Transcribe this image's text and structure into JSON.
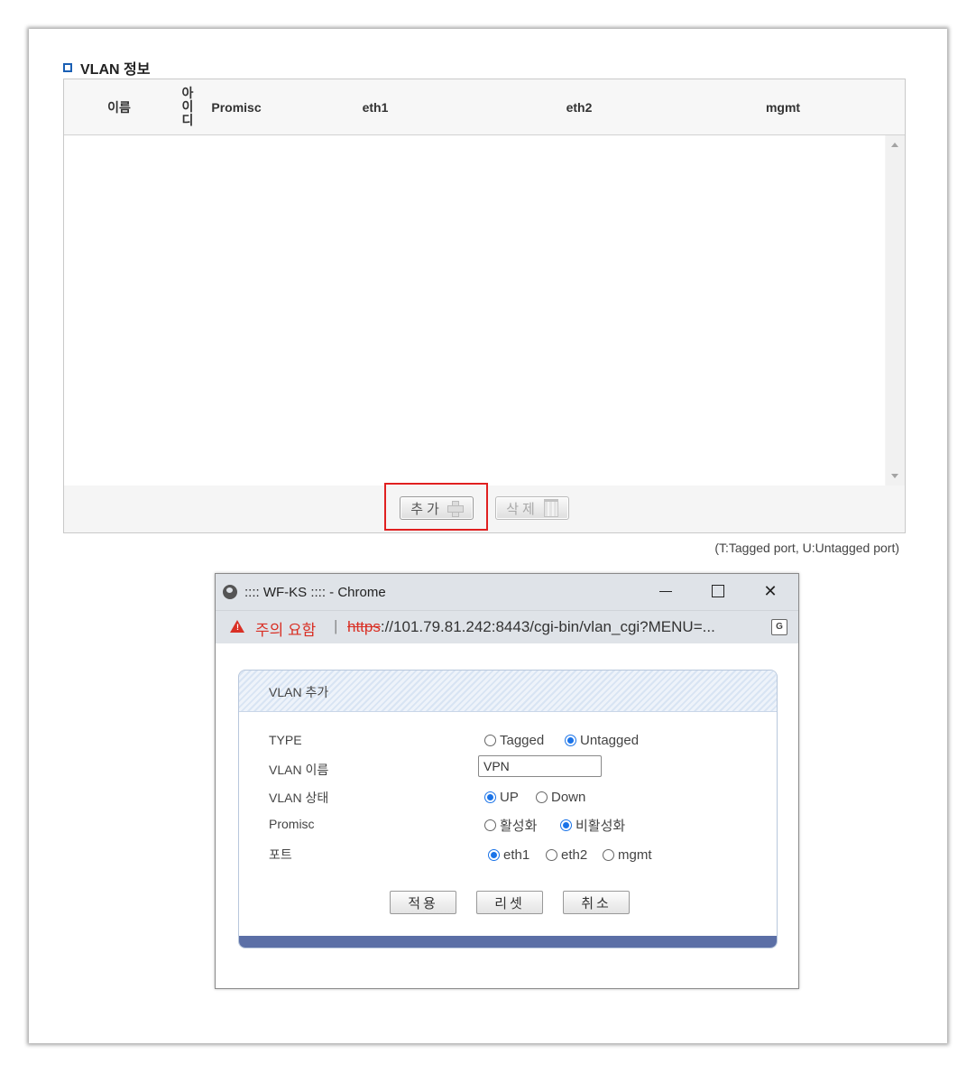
{
  "section": {
    "title": "VLAN 정보"
  },
  "table": {
    "headers": {
      "name": "이름",
      "id": [
        "아",
        "이",
        "디"
      ],
      "promisc": "Promisc",
      "eth1": "eth1",
      "eth2": "eth2",
      "mgmt": "mgmt"
    },
    "rows": []
  },
  "table_buttons": {
    "add": "추가",
    "delete": "삭제"
  },
  "note": "(T:Tagged port, U:Untagged port)",
  "popup": {
    "window_title": ":::: WF-KS :::: - Chrome",
    "warning": "주의 요함",
    "url_scheme": "https",
    "url_rest": "://101.79.81.242:8443/cgi-bin/vlan_cgi?MENU=...",
    "dialog": {
      "title": "VLAN 추가",
      "labels": {
        "type": "TYPE",
        "vlan_name": "VLAN 이름",
        "vlan_state": "VLAN 상태",
        "promisc": "Promisc",
        "port": "포트"
      },
      "type_options": {
        "tagged": "Tagged",
        "untagged": "Untagged",
        "selected": "Untagged"
      },
      "vlan_name_value": "VPN",
      "state_options": {
        "up": "UP",
        "down": "Down",
        "selected": "UP"
      },
      "promisc_options": {
        "on": "활성화",
        "off": "비활성화",
        "selected": "비활성화"
      },
      "port_options": {
        "eth1": "eth1",
        "eth2": "eth2",
        "mgmt": "mgmt",
        "selected": "eth1"
      },
      "buttons": {
        "apply": "적용",
        "reset": "리셋",
        "cancel": "취소"
      }
    }
  },
  "colors": {
    "highlight": "#e02020",
    "accent": "#1a73e8",
    "footer": "#5b6fa6",
    "warning": "#d93025"
  }
}
